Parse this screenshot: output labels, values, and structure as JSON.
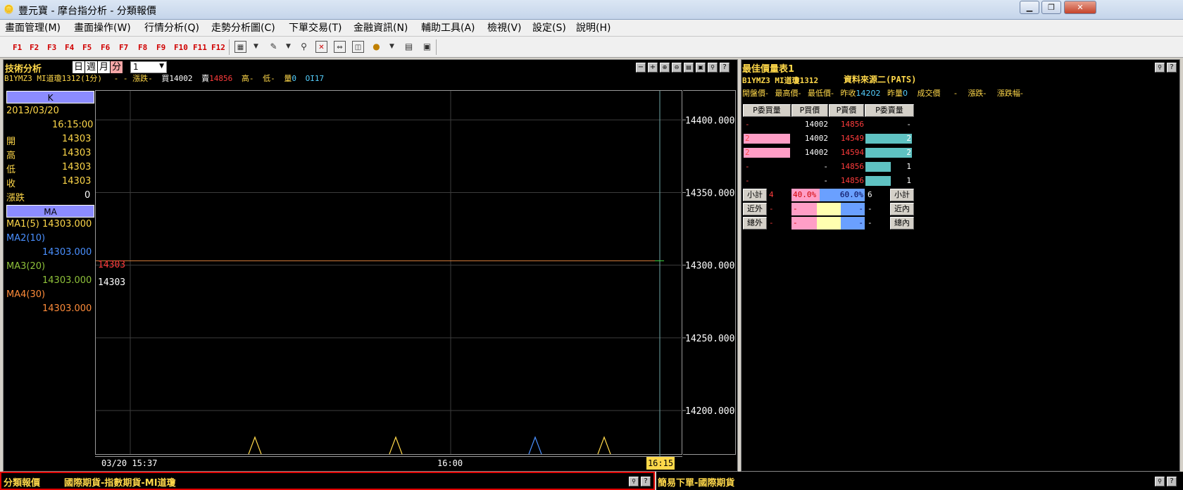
{
  "window": {
    "app_icon": "coin-icon",
    "title": "豐元寶 - 摩台指分析 - 分類報價",
    "minimize": "▁",
    "restore": "❐",
    "close": "✕"
  },
  "menu": [
    "畫面管理(M)",
    "畫面操作(W)",
    "行情分析(Q)",
    "走勢分析圖(C)",
    "下單交易(T)",
    "金融資訊(N)",
    "輔助工具(A)",
    "檢視(V)",
    "設定(S)",
    "說明(H)"
  ],
  "fkeys": [
    "F1",
    "F2",
    "F3",
    "F4",
    "F5",
    "F6",
    "F7",
    "F8",
    "F9",
    "F10",
    "F11",
    "F12"
  ],
  "toolbar_icons": [
    "layout-icon",
    "dropdown-icon",
    "edit-icon",
    "dropdown-icon",
    "search-icon",
    "close-chart-icon",
    "zoom-fit-icon",
    "split-icon",
    "coin-icon",
    "dropdown-icon",
    "book-icon",
    "window-icon"
  ],
  "tech": {
    "title": "技術分析",
    "periods": [
      "日",
      "週",
      "月",
      "分"
    ],
    "active_period": "分",
    "interval_value": "1",
    "info": {
      "symbol": "B1YMZ3  MI道瓊1312(1分)",
      "change_label": "-    -  漲跌-",
      "bid_label": "買14002",
      "ask_label": "賣",
      "ask_value": "14856",
      "high": "高-",
      "low": "低-",
      "volume_label": "量",
      "volume_value": "0",
      "oi": "OI17"
    },
    "window_buttons": [
      "−",
      "+",
      "🔍",
      "🔍",
      "🖫",
      "🖫",
      "🔍",
      "?"
    ],
    "k_header": "K",
    "date": "2013/03/20",
    "time": "16:15:00",
    "ohlc": [
      {
        "label": "開",
        "value": "14303"
      },
      {
        "label": "高",
        "value": "14303"
      },
      {
        "label": "低",
        "value": "14303"
      },
      {
        "label": "收",
        "value": "14303"
      },
      {
        "label": "漲跌",
        "value": "0"
      }
    ],
    "ma_header": "MA",
    "ma": [
      {
        "label": "MA1(5)",
        "value": "14303.000",
        "color": "#ffd84a"
      },
      {
        "label": "MA2(10)",
        "value": "14303.000",
        "color": "#4a90ff"
      },
      {
        "label": "MA3(20)",
        "value": "14303.000",
        "color": "#8fc23a"
      },
      {
        "label": "MA4(30)",
        "value": "14303.000",
        "color": "#ff8c3a"
      }
    ],
    "price_tag_red": "14303",
    "price_tag_white": "14303",
    "time_labels": {
      "start": "03/20 15:37",
      "mid": "16:00",
      "end": "16:15"
    }
  },
  "chart_data": {
    "type": "line",
    "y_ticks": [
      14200,
      14250,
      14300,
      14350,
      14400
    ],
    "y_tick_labels": [
      "14200.000",
      "14250.000",
      "14300.000",
      "14350.000",
      "14400.000"
    ],
    "ylim": [
      14170,
      14420
    ],
    "series": [
      {
        "name": "MA1(5)",
        "value": 14303
      }
    ],
    "volume_peaks": [
      {
        "color": "#ffd84a"
      },
      {
        "color": "#ffd84a"
      },
      {
        "color": "#4a90ff"
      },
      {
        "color": "#ffd84a"
      }
    ]
  },
  "best": {
    "title": "最佳價量表1",
    "symbol": "B1YMZ3  MI道瓊1312",
    "source": "資料來源二(PATS)",
    "row2": {
      "open": "開盤價-",
      "high": "最高價-",
      "low": "最低價-",
      "prev_label": "昨收",
      "prev_value": "14202",
      "pvol_label": "昨量",
      "pvol_value": "0",
      "trade": "成交價",
      "trade_value": "-",
      "chg": "漲跌-",
      "chgpct": "漲跌幅-"
    },
    "headers": [
      "P委買量",
      "P買價",
      "P賣價",
      "P委賣量"
    ],
    "rows": [
      {
        "bq": "-",
        "bp": "14002",
        "sp": "14856",
        "sq": "-",
        "bqbar": 0,
        "sqbar": 0
      },
      {
        "bq": "2",
        "bp": "14002",
        "sp": "14549",
        "sq": "2",
        "bqbar": 1,
        "sqbar": 1
      },
      {
        "bq": "2",
        "bp": "14002",
        "sp": "14594",
        "sq": "2",
        "bqbar": 1,
        "sqbar": 1
      },
      {
        "bq": "-",
        "bp": "-",
        "sp": "14856",
        "sq": "1",
        "bqbar": 0,
        "sqbar": 0.55
      },
      {
        "bq": "-",
        "bp": "-",
        "sp": "14856",
        "sq": "1",
        "bqbar": 0,
        "sqbar": 0.55
      }
    ],
    "subtotal": {
      "label_left": "小計",
      "left_val": "4",
      "buy_pct": "40.0%",
      "sell_pct": "60.0%",
      "right_val": "6",
      "label_right": "小計"
    },
    "near": {
      "label_left": "近外",
      "v1": "-",
      "b1": "-",
      "b2": "-",
      "v2": "-",
      "label_right": "近內"
    },
    "total": {
      "label_left": "總外",
      "v1": "-",
      "b1": "-",
      "b2": "-",
      "v2": "-",
      "label_right": "總內"
    },
    "buttons": [
      "🔍",
      "?"
    ]
  },
  "bottom": {
    "left_title": "分類報價",
    "left_path": "國際期貨-指數期貨-MI道瓊",
    "right_title": "簡易下單-國際期貨"
  }
}
